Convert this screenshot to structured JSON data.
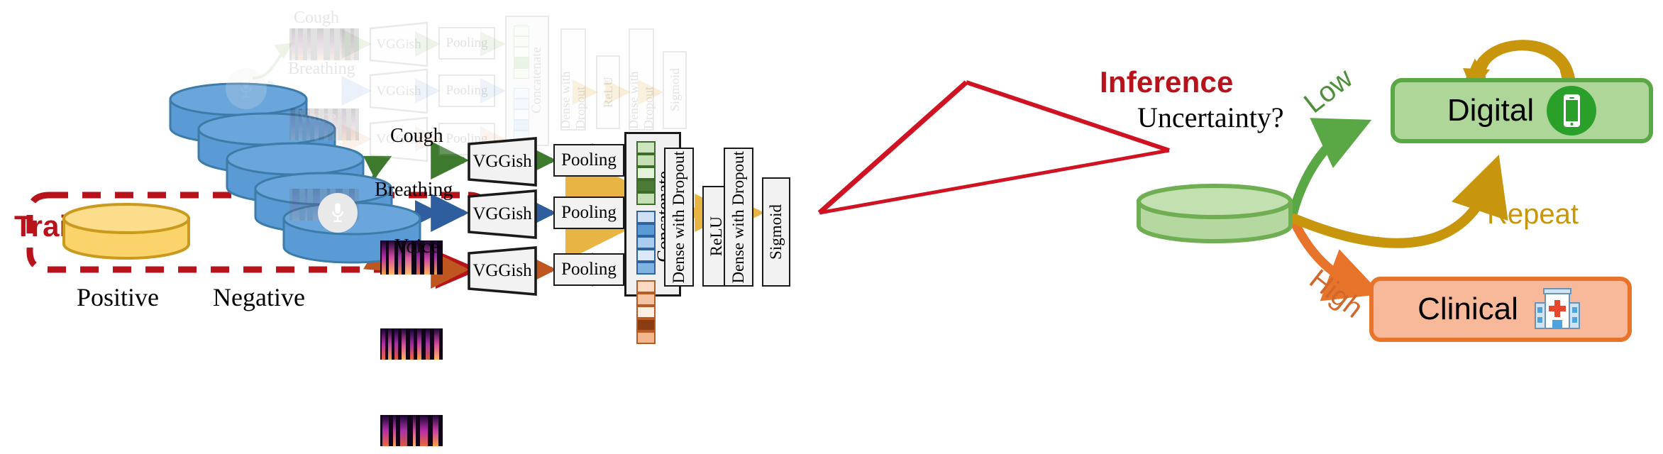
{
  "phases": {
    "training_label": "Training",
    "inference_label": "Inference"
  },
  "training": {
    "positive_label": "Positive",
    "negative_label": "Negative",
    "positive_color": "#f7cf62",
    "negative_color": "#5b9bd5",
    "selection_box_color": "#b8121b"
  },
  "pipeline_background": {
    "modalities": [
      {
        "name": "Cough",
        "arrow_color": "#aacf9a"
      },
      {
        "name": "Breathing",
        "arrow_color": "#a8c4e5"
      },
      {
        "name": "Voice",
        "arrow_color": "#f2c3a5"
      }
    ],
    "encoder_label": "VGGish",
    "pooling_label": "Pooling",
    "concatenate_label": "Concatenate",
    "head": [
      "Dense with Dropout",
      "ReLU",
      "Dense with Dropout",
      "Sigmoid"
    ]
  },
  "pipeline_main": {
    "modalities": [
      {
        "name": "Cough",
        "arrow_color": "#3d7a2e"
      },
      {
        "name": "Breathing",
        "arrow_color": "#2e5e9e"
      },
      {
        "name": "Voice",
        "arrow_color": "#c0561f"
      }
    ],
    "encoder_label": "VGGish",
    "pooling_label": "Pooling",
    "concatenate_label": "Concatenate",
    "head": [
      "Dense with Dropout",
      "ReLU",
      "Dense with Dropout",
      "Sigmoid"
    ],
    "fusion_arrow_color": "#e8b545"
  },
  "inference": {
    "uncertainty_label": "Uncertainty?",
    "uncertainty_cylinder_color": "#8ec07c",
    "branches": [
      {
        "label": "Low",
        "color": "#5aa845",
        "target": "Digital"
      },
      {
        "label": "High",
        "color": "#e8742c",
        "target": "Clinical"
      }
    ],
    "repeat_label": "Repeat",
    "repeat_color": "#c8960c",
    "outcomes": [
      {
        "label": "Digital",
        "icon": "smartphone-icon",
        "fill": "#aed699",
        "border": "#5aa845"
      },
      {
        "label": "Clinical",
        "icon": "hospital-icon",
        "fill": "#f7b99a",
        "border": "#e8742c"
      }
    ]
  }
}
